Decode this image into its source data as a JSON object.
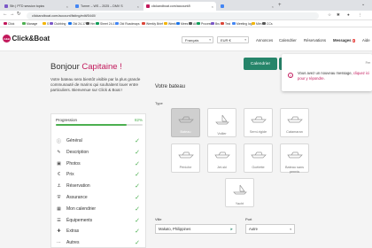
{
  "browser": {
    "tabs": [
      {
        "label": "Sth | PTD session topics",
        "color": "#7b57c7"
      },
      {
        "label": "Turner – WS – 2025 – DMV S",
        "color": "#4285f4"
      },
      {
        "label": "clickandboat.com/account/li",
        "color": "#c2185b"
      },
      {
        "label": "",
        "color": "#4285f4"
      }
    ],
    "new_tab": "+",
    "window_controls": [
      "⌄"
    ],
    "url": "clickandboat.com/account/listing/edit/5440/",
    "bookmarks": [
      {
        "label": "Click",
        "color": "#c2185b"
      },
      {
        "label": "Manage",
        "color": "#4caf50"
      },
      {
        "label": "S",
        "color": "#f4b400"
      },
      {
        "label": "Clubbing",
        "color": "#7b57c7"
      },
      {
        "label": "Old 24-17",
        "color": "#1a73e8"
      },
      {
        "label": "Hm",
        "color": "#555555"
      },
      {
        "label": "Sheet 24-17",
        "color": "#0f9d58"
      },
      {
        "label": "Old Roadmaps",
        "color": "#4285f4"
      },
      {
        "label": "Weekly Brief",
        "color": "#db4437"
      },
      {
        "label": "Week",
        "color": "#f4b400"
      },
      {
        "label": "Mees",
        "color": "#1a73e8"
      },
      {
        "label": "All",
        "color": "#555555"
      },
      {
        "label": "Process",
        "color": "#0f9d58"
      },
      {
        "label": "Bru",
        "color": "#7b57c7"
      },
      {
        "label": "Test",
        "color": "#db4437"
      },
      {
        "label": "Meeting log",
        "color": "#4285f4"
      },
      {
        "label": "Mim",
        "color": "#f4b400"
      },
      {
        "label": "CCs",
        "color": "#555555"
      }
    ]
  },
  "header": {
    "logo": "Click&Boat",
    "logo_mark": "C&B",
    "language": "Français",
    "currency": "EUR  €",
    "nav": {
      "annonces": "Annonces",
      "calendrier": "Calendrier",
      "reservations": "Réservations",
      "messages": "Messages",
      "messages_badge": "2",
      "aide": "Aide"
    }
  },
  "welcome": {
    "greeting": "Bonjour ",
    "name": "Capitaine !",
    "text": "Votre bateau sera bientôt visible par la plus grande communauté de marins qui souhaitent louer entre particuliers. Bienvenue sur Click & Boat !"
  },
  "progress": {
    "label": "Progression",
    "percent_text": "82%",
    "percent": 82,
    "steps": [
      {
        "label": "Général",
        "icon": "info-icon",
        "glyph": "ⓘ"
      },
      {
        "label": "Description",
        "icon": "pencil-icon",
        "glyph": "✎"
      },
      {
        "label": "Photos",
        "icon": "camera-icon",
        "glyph": "▣"
      },
      {
        "label": "Prix",
        "icon": "euro-icon",
        "glyph": "€"
      },
      {
        "label": "Réservation",
        "icon": "anchor-icon",
        "glyph": "⚓"
      },
      {
        "label": "Assurance",
        "icon": "shield-icon",
        "glyph": "⛨"
      },
      {
        "label": "Mon calendrier",
        "icon": "calendar-icon",
        "glyph": "▦"
      },
      {
        "label": "Équipements",
        "icon": "list-icon",
        "glyph": "☰"
      },
      {
        "label": "Extras",
        "icon": "plus-icon",
        "glyph": "✚"
      },
      {
        "label": "Autres",
        "icon": "dots-icon",
        "glyph": "⋯"
      }
    ],
    "check_glyph": "✓"
  },
  "actions": {
    "calendar_button": "Calendrier"
  },
  "notification": {
    "text": "Vous avez un nouveau message, ",
    "link": "cliquez ici pour y répondre.",
    "corner": "Fer"
  },
  "boat": {
    "section_title": "Votre bateau",
    "type_label": "Type",
    "types": [
      {
        "label": "Bateau",
        "selected": true
      },
      {
        "label": "Voilier",
        "selected": false
      },
      {
        "label": "Semi-rigide",
        "selected": false
      },
      {
        "label": "Catamaran",
        "selected": false
      },
      {
        "label": "Péniche",
        "selected": false
      },
      {
        "label": "Jet-ski",
        "selected": false
      },
      {
        "label": "Goélette",
        "selected": false
      },
      {
        "label": "Bateau sans permis",
        "selected": false
      },
      {
        "label": "Yacht",
        "selected": false
      }
    ],
    "ville_label": "Ville",
    "ville_value": "Makato, Philippines",
    "port_label": "Port",
    "port_value": "Autre"
  },
  "colors": {
    "brand": "#c2185b",
    "success": "#4caf50",
    "action": "#26856a"
  }
}
